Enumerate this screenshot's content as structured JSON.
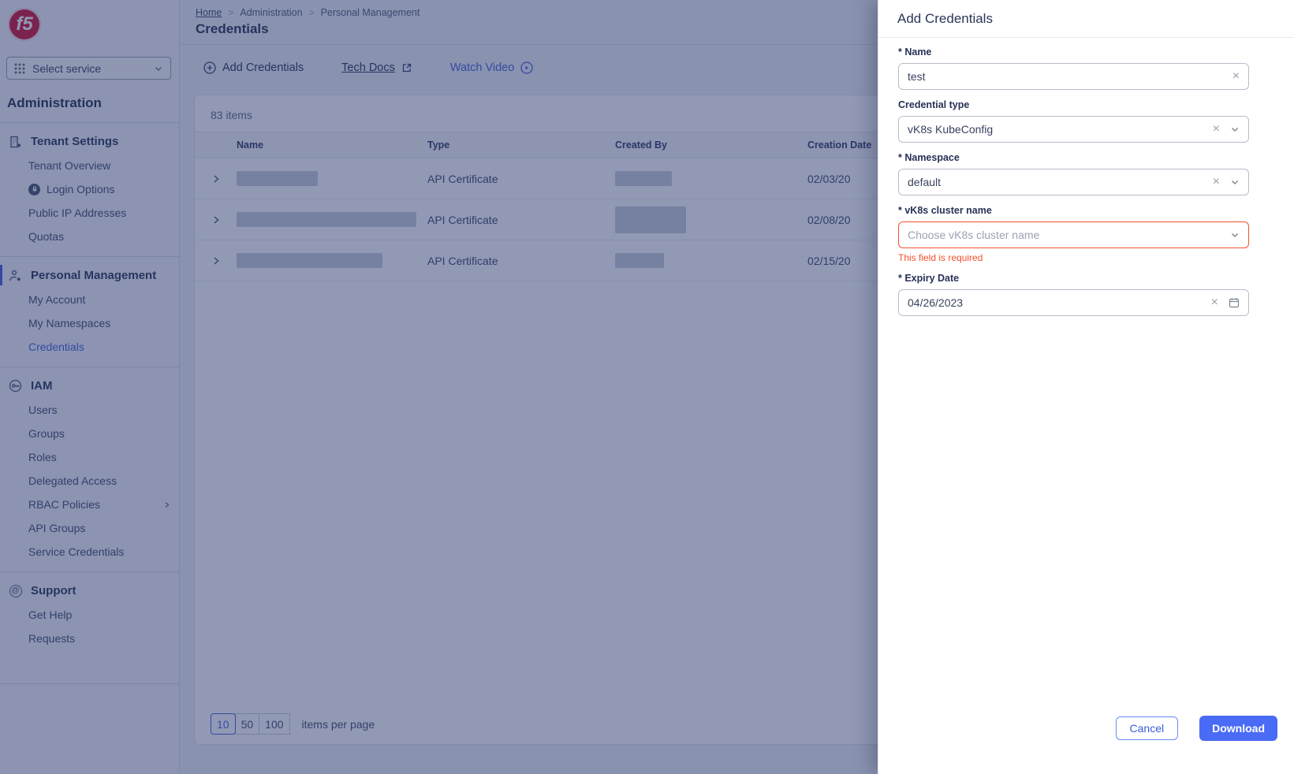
{
  "sidebar": {
    "logo_text": "f5",
    "select_service_label": "Select service",
    "title": "Administration",
    "sections": [
      {
        "title": "Tenant Settings",
        "items": [
          {
            "label": "Tenant Overview"
          },
          {
            "label": "Login Options"
          },
          {
            "label": "Public IP Addresses"
          },
          {
            "label": "Quotas"
          }
        ]
      },
      {
        "title": "Personal Management",
        "items": [
          {
            "label": "My Account"
          },
          {
            "label": "My Namespaces"
          },
          {
            "label": "Credentials"
          }
        ]
      },
      {
        "title": "IAM",
        "items": [
          {
            "label": "Users"
          },
          {
            "label": "Groups"
          },
          {
            "label": "Roles"
          },
          {
            "label": "Delegated Access"
          },
          {
            "label": "RBAC Policies"
          },
          {
            "label": "API Groups"
          },
          {
            "label": "Service Credentials"
          }
        ]
      },
      {
        "title": "Support",
        "items": [
          {
            "label": "Get Help"
          },
          {
            "label": "Requests"
          }
        ]
      }
    ]
  },
  "breadcrumb": {
    "items": [
      "Home",
      "Administration",
      "Personal Management"
    ]
  },
  "page": {
    "title": "Credentials"
  },
  "toolbar": {
    "add_credentials": "Add Credentials",
    "tech_docs": "Tech Docs",
    "watch_video": "Watch Video"
  },
  "table": {
    "items_count": "83 items",
    "columns": [
      "Name",
      "Type",
      "Created By",
      "Creation Date"
    ],
    "rows": [
      {
        "type": "API Certificate",
        "creation_date": "02/03/20"
      },
      {
        "type": "API Certificate",
        "creation_date": "02/08/20"
      },
      {
        "type": "API Certificate",
        "creation_date": "02/15/20"
      }
    ]
  },
  "pagination": {
    "options": [
      "10",
      "50",
      "100"
    ],
    "selected": "10",
    "label": "items per page"
  },
  "drawer": {
    "title": "Add Credentials",
    "fields": {
      "name": {
        "label": "* Name",
        "value": "test"
      },
      "credential_type": {
        "label": "Credential type",
        "value": "vK8s KubeConfig"
      },
      "namespace": {
        "label": "* Namespace",
        "value": "default"
      },
      "cluster": {
        "label": "* vK8s cluster name",
        "placeholder": "Choose vK8s cluster name",
        "error": "This field is required"
      },
      "expiry": {
        "label": "* Expiry Date",
        "value": "04/26/2023"
      }
    },
    "cancel_label": "Cancel",
    "download_label": "Download"
  },
  "colors": {
    "accent": "#3b5bdb",
    "button_blue": "#4a6bf5",
    "error": "#f4512c",
    "logo_red": "#cf0a2c"
  }
}
